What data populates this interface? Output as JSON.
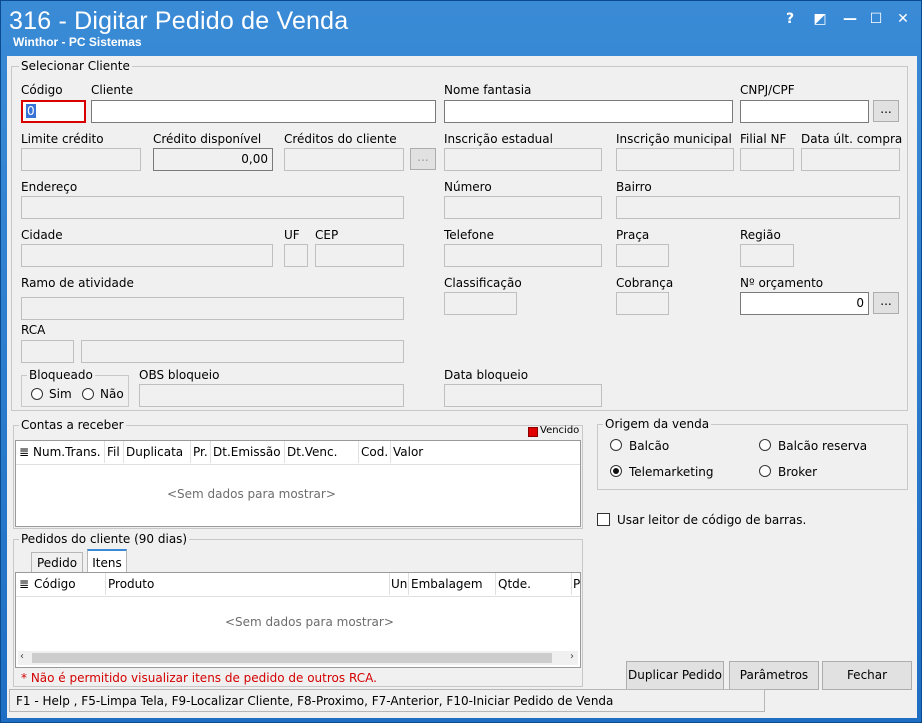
{
  "window": {
    "title": "316 - Digitar Pedido de Venda",
    "subtitle": "Winthor - PC Sistemas",
    "buttons": [
      "?",
      "◩",
      "—",
      "☐",
      "✕"
    ]
  },
  "cliente": {
    "group_title": "Selecionar Cliente",
    "codigo_label": "Código",
    "codigo_value": "0",
    "cliente_label": "Cliente",
    "nome_fantasia_label": "Nome fantasia",
    "cnpj_label": "CNPJ/CPF",
    "limite_credito_label": "Limite crédito",
    "credito_disponivel_label": "Crédito disponível",
    "credito_disponivel_value": "0,00",
    "creditos_cliente_label": "Créditos do cliente",
    "inscricao_estadual_label": "Inscrição estadual",
    "inscricao_municipal_label": "Inscrição municipal",
    "filial_nf_label": "Filial NF",
    "data_ult_compra_label": "Data últ. compra",
    "endereco_label": "Endereço",
    "numero_label": "Número",
    "bairro_label": "Bairro",
    "cidade_label": "Cidade",
    "uf_label": "UF",
    "cep_label": "CEP",
    "telefone_label": "Telefone",
    "praca_label": "Praça",
    "regiao_label": "Região",
    "ramo_label": "Ramo de atividade",
    "classificacao_label": "Classificação",
    "cobranca_label": "Cobrança",
    "orcamento_label": "Nº orçamento",
    "orcamento_value": "0",
    "rca_label": "RCA",
    "bloqueado_label": "Bloqueado",
    "sim_label": "Sim",
    "nao_label": "Não",
    "obs_bloqueio_label": "OBS bloqueio",
    "data_bloqueio_label": "Data bloqueio",
    "ellipsis": "..."
  },
  "contas": {
    "group_title": "Contas a receber",
    "vencido_label": "Vencido",
    "vencido_color": "#e00000",
    "columns": [
      "Num.Trans.",
      "Fil",
      "Duplicata",
      "Pr.",
      "Dt.Emissão",
      "Dt.Venc.",
      "Cod.",
      "Valor"
    ],
    "empty_text": "<Sem dados para mostrar>"
  },
  "origem": {
    "group_title": "Origem da venda",
    "options": [
      "Balcão",
      "Balcão reserva",
      "Telemarketing",
      "Broker"
    ],
    "selected": "Telemarketing"
  },
  "barcode_label": "Usar leitor de código de barras.",
  "pedidos": {
    "group_title": "Pedidos do cliente (90 dias)",
    "tabs": [
      "Pedido",
      "Itens"
    ],
    "active_tab": "Itens",
    "columns": [
      "Código",
      "Produto",
      "Un",
      "Embalagem",
      "Qtde.",
      "P"
    ],
    "empty_text": "<Sem dados para mostrar>",
    "warning": "* Não é permitido visualizar itens de pedido de outros RCA."
  },
  "actions": {
    "duplicar": "Duplicar Pedido",
    "parametros": "Parâmetros",
    "fechar": "Fechar"
  },
  "status_bar": "F1 - Help , F5-Limpa Tela, F9-Localizar Cliente, F8-Proximo, F7-Anterior, F10-Iniciar Pedido de Venda"
}
